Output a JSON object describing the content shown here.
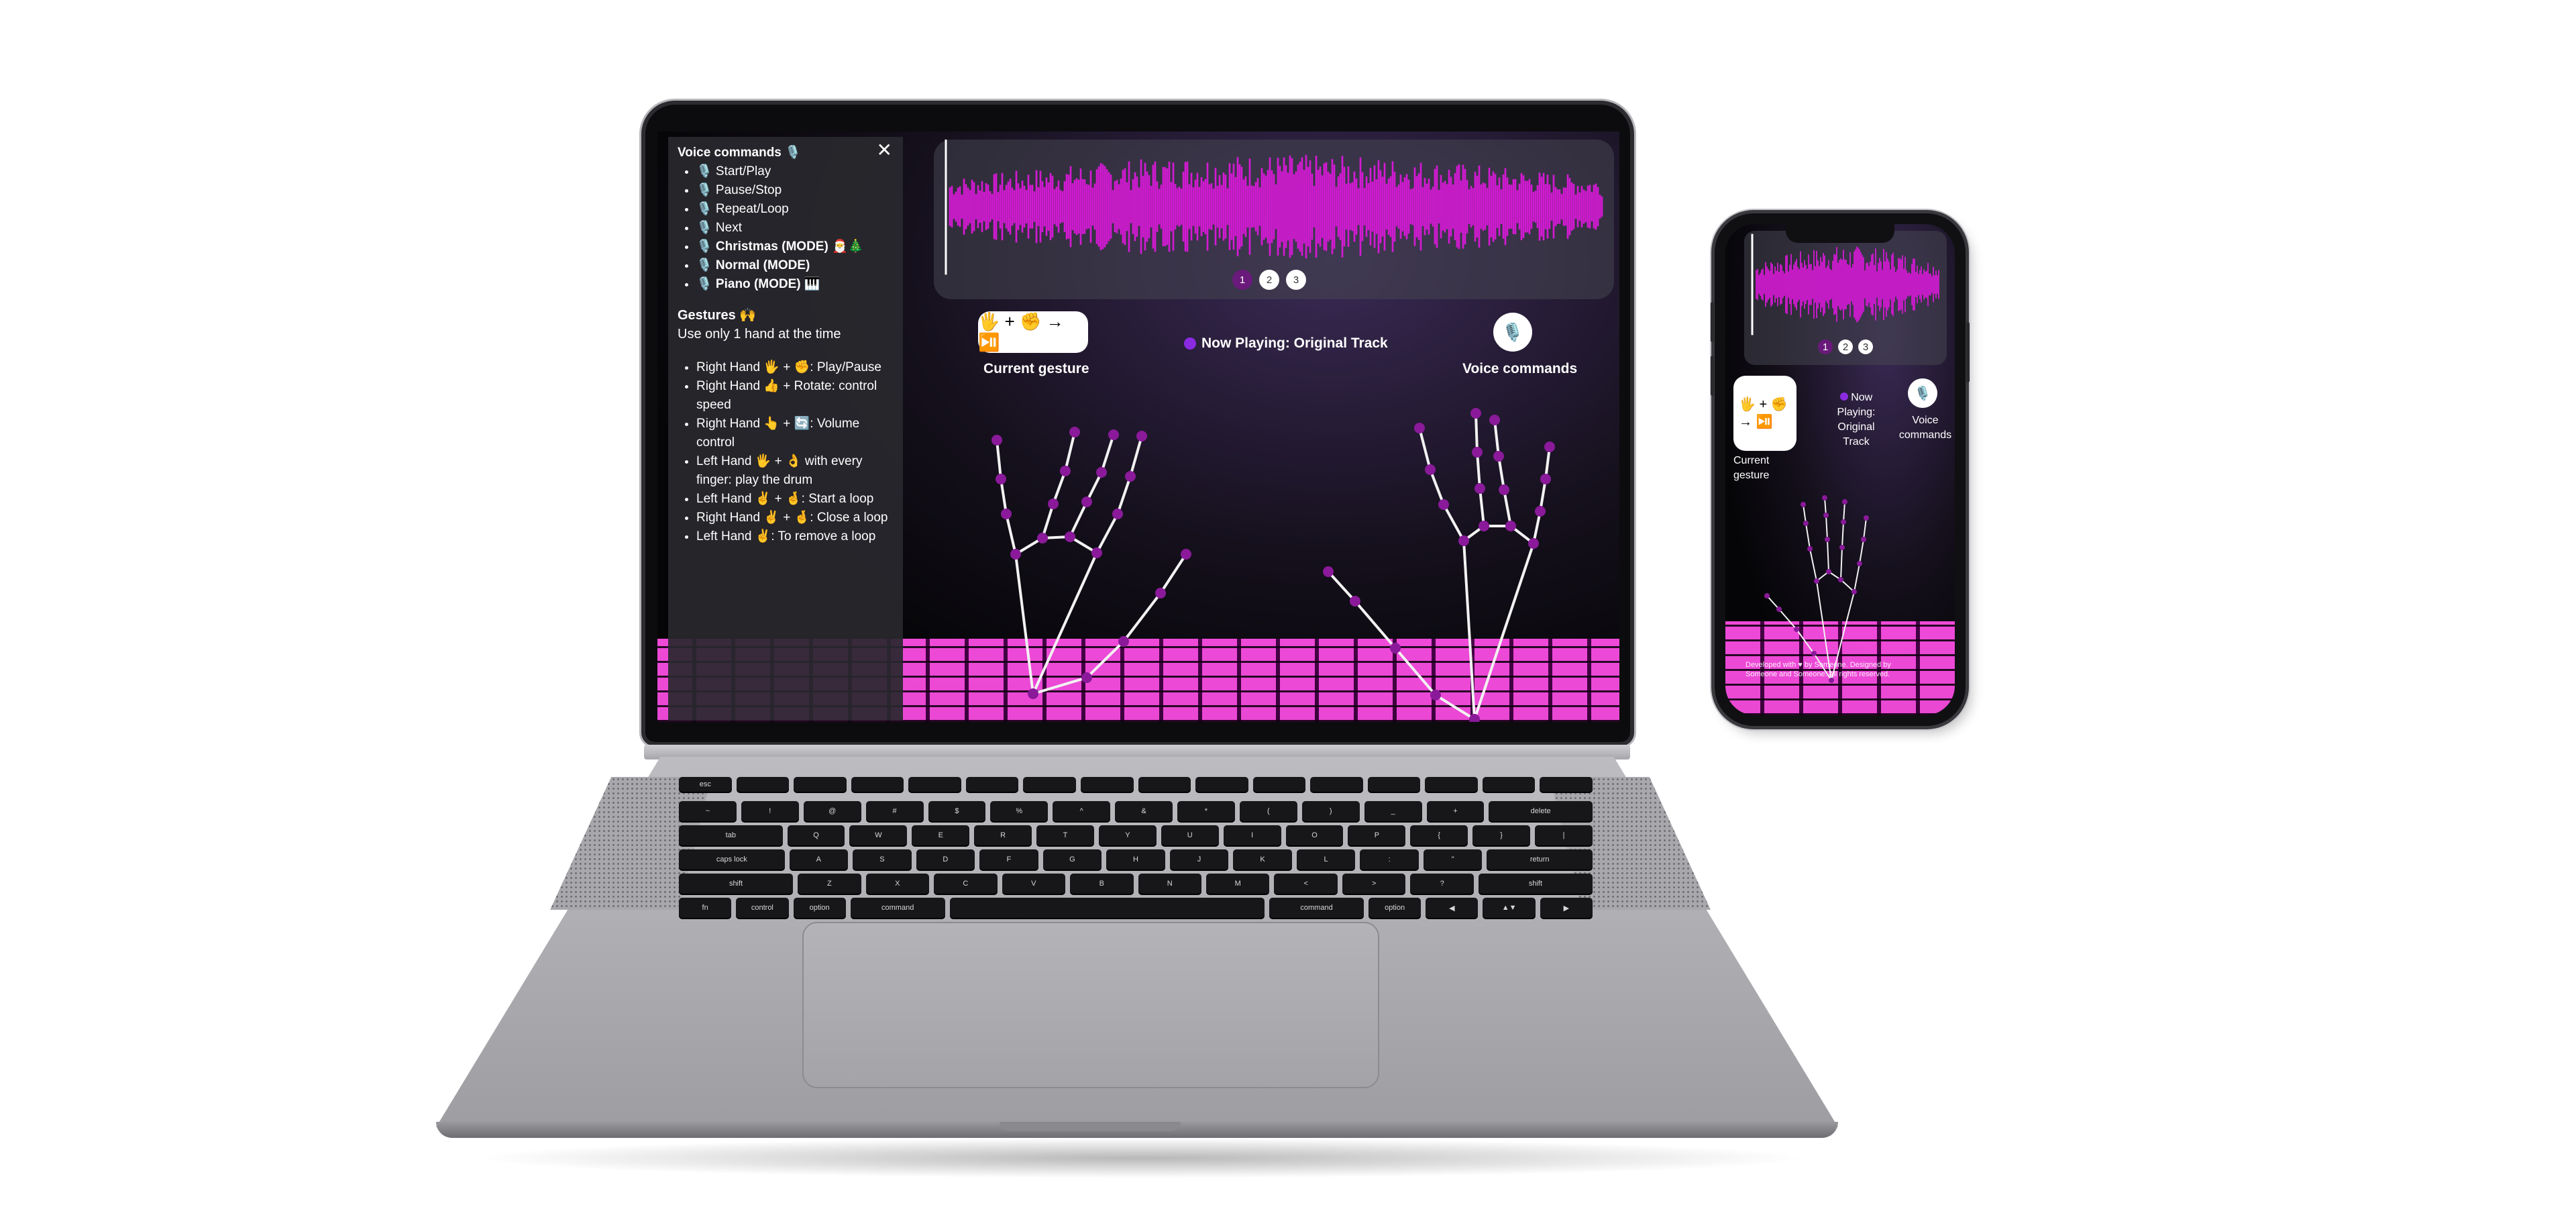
{
  "voice_panel": {
    "title": "Voice commands 🎙️",
    "items": [
      {
        "label": "🎙️ Start/Play",
        "bold": false
      },
      {
        "label": "🎙️ Pause/Stop",
        "bold": false
      },
      {
        "label": "🎙️ Repeat/Loop",
        "bold": false
      },
      {
        "label": "🎙️ Next",
        "bold": false
      },
      {
        "label": "🎙️ Christmas (MODE) 🎅🎄",
        "bold": true
      },
      {
        "label": "🎙️ Normal (MODE)",
        "bold": true
      },
      {
        "label": "🎙️ Piano (MODE) 🎹",
        "bold": true
      }
    ],
    "close": "✕"
  },
  "gestures_panel": {
    "title": "Gestures 🙌",
    "subtitle": "Use only 1 hand at the time",
    "items": [
      "Right Hand 🖐️ + ✊: Play/Pause",
      "Right Hand 👍 + Rotate: control speed",
      "Right Hand 👆 + 🔄: Volume control",
      "Left Hand 🖐️ + 👌 with every finger: play the drum",
      "Left Hand ✌️ + 🤞: Start a loop",
      "Right Hand ✌️ + 🤞: Close a loop",
      "Left Hand ✌️: To remove a loop"
    ]
  },
  "pager": {
    "pages": [
      "1",
      "2",
      "3"
    ],
    "active": "1"
  },
  "gesture_widget": {
    "icons": "🖐️ + ✊ → ⏯️",
    "label": "Current gesture"
  },
  "now_playing": {
    "text": "Now Playing: Original Track"
  },
  "voice_widget": {
    "icon": "🎙️",
    "label": "Voice commands"
  },
  "phone": {
    "gesture_icons": "🖐️ + ✊ → ⏯️",
    "gesture_label": "Current gesture",
    "now_playing": "Now Playing: Original Track",
    "voice_label": "Voice commands",
    "mic": "🎙️",
    "footer": "Developed with ♥ by Someone. Designed by Someone and Someone. All rights reserved."
  },
  "colors": {
    "accent": "#d21ad2",
    "dot": "#8a2be2",
    "active_page": "#6a1a7a",
    "joint": "#8a1a9a"
  }
}
